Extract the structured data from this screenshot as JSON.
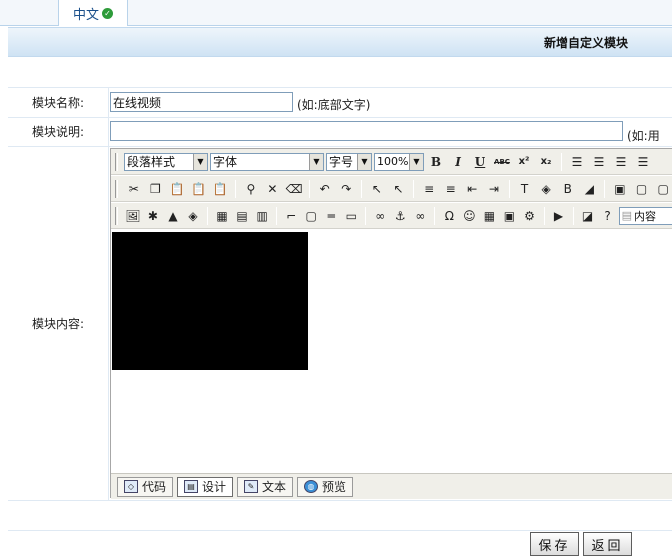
{
  "tabs": [
    {
      "label": "中文",
      "status_icon": "check-circle-icon"
    }
  ],
  "page": {
    "title": "新增自定义模块"
  },
  "form": {
    "name_label": "模块名称:",
    "name_value": "在线视频",
    "name_hint": "(如:底部文字)",
    "desc_label": "模块说明:",
    "desc_value": "",
    "desc_hint": "(如:用",
    "content_label": "模块内容:"
  },
  "editor": {
    "paragraph_style": "段落样式",
    "font": "字体",
    "font_size": "字号",
    "zoom": "100%",
    "insert_content": "内容",
    "modes": [
      {
        "label": "代码",
        "icon": "code-icon"
      },
      {
        "label": "设计",
        "icon": "design-icon"
      },
      {
        "label": "文本",
        "icon": "text-icon"
      },
      {
        "label": "预览",
        "icon": "globe-icon"
      }
    ],
    "active_mode": "设计",
    "accent_color": "#f0efe9"
  },
  "actions": {
    "save": "保存",
    "back": "返回"
  }
}
